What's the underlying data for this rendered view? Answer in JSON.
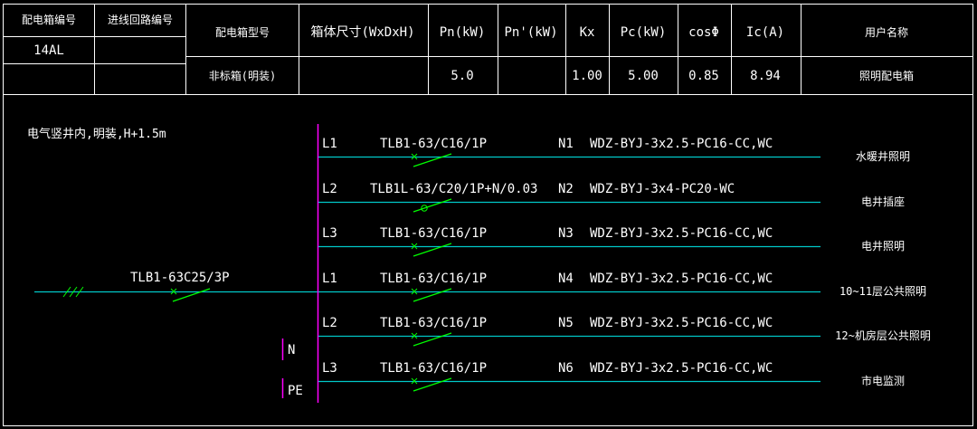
{
  "colors": {
    "background": "#000000",
    "border": "#ffffff",
    "text": "#ffffff",
    "wire": "#00c8c8",
    "breaker": "#00ff00",
    "busbar": "#ff00ff"
  },
  "table": {
    "headers": {
      "box_no": "配电箱编号",
      "incoming_no": "进线回路编号",
      "box_model": "配电箱型号",
      "box_size": "箱体尺寸(WxDxH)",
      "pn": "Pn(kW)",
      "pn2": "Pn'(kW)",
      "kx": "Kx",
      "pc": "Pc(kW)",
      "cos": "cosΦ",
      "ic": "Ic(A)",
      "user": "用户名称"
    },
    "values": {
      "box_no": "14AL",
      "box_model": "非标箱(明装)",
      "pn": "5.0",
      "kx": "1.00",
      "pc": "5.00",
      "cos": "0.85",
      "ic": "8.94",
      "user": "照明配电箱"
    }
  },
  "diagram": {
    "install_note": "电气竖井内,明装,H+1.5m",
    "main_breaker": "TLB1-63C25/3P",
    "n_label": "N",
    "pe_label": "PE",
    "circuits": [
      {
        "phase": "L1",
        "breaker": "TLB1-63/C16/1P",
        "no": "N1",
        "cable": "WDZ-BYJ-3x2.5-PC16-CC,WC",
        "name": "水暖井照明"
      },
      {
        "phase": "L2",
        "breaker": "TLB1L-63/C20/1P+N/0.03",
        "no": "N2",
        "cable": "WDZ-BYJ-3x4-PC20-WC",
        "name": "电井插座"
      },
      {
        "phase": "L3",
        "breaker": "TLB1-63/C16/1P",
        "no": "N3",
        "cable": "WDZ-BYJ-3x2.5-PC16-CC,WC",
        "name": "电井照明"
      },
      {
        "phase": "L1",
        "breaker": "TLB1-63/C16/1P",
        "no": "N4",
        "cable": "WDZ-BYJ-3x2.5-PC16-CC,WC",
        "name": "10~11层公共照明"
      },
      {
        "phase": "L2",
        "breaker": "TLB1-63/C16/1P",
        "no": "N5",
        "cable": "WDZ-BYJ-3x2.5-PC16-CC,WC",
        "name": "12~机房层公共照明"
      },
      {
        "phase": "L3",
        "breaker": "TLB1-63/C16/1P",
        "no": "N6",
        "cable": "WDZ-BYJ-3x2.5-PC16-CC,WC",
        "name": "市电监测"
      }
    ]
  }
}
